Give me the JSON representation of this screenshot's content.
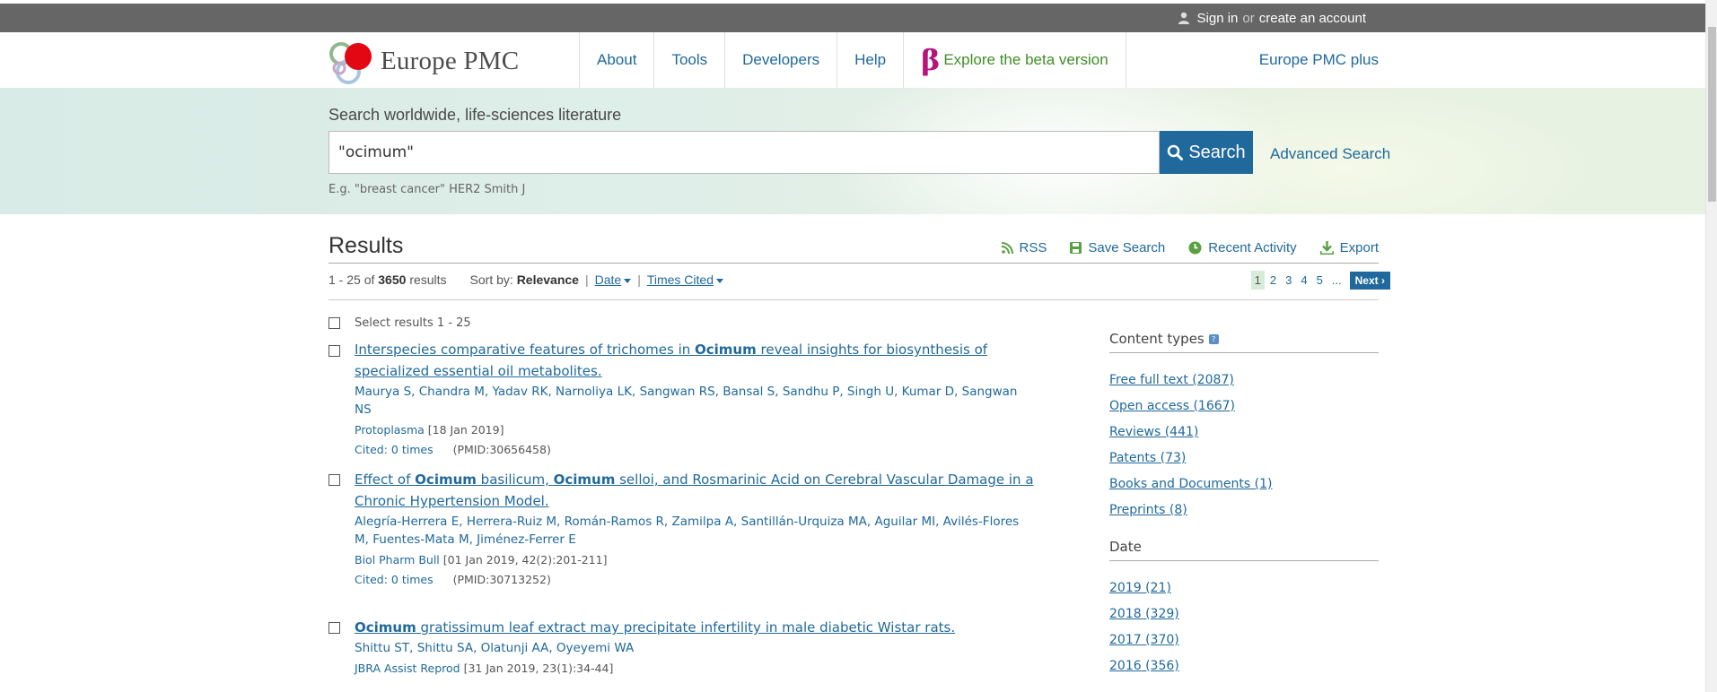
{
  "topbar": {
    "sign_in": "Sign in",
    "or": "or",
    "create_account": "create an account"
  },
  "header": {
    "logo_text": "Europe PMC",
    "nav": [
      "About",
      "Tools",
      "Developers",
      "Help"
    ],
    "beta_symbol": "β",
    "beta_label": "Explore the beta version",
    "plus": "Europe PMC plus"
  },
  "search": {
    "label": "Search worldwide, life-sciences literature",
    "value": "\"ocimum\"",
    "button": "Search",
    "advanced": "Advanced Search",
    "example": "E.g. \"breast cancer\" HER2 Smith J"
  },
  "results": {
    "heading": "Results",
    "tools": [
      "RSS",
      "Save Search",
      "Recent Activity",
      "Export"
    ],
    "range": "1 - 25 of",
    "total": "3650",
    "results_word": "results",
    "sort_by": "Sort by:",
    "sort_current": "Relevance",
    "sort_options": [
      "Date",
      "Times Cited"
    ],
    "pages": [
      "1",
      "2",
      "3",
      "4",
      "5",
      "..."
    ],
    "next": "Next",
    "select_all": "Select results 1 - 25",
    "items": [
      {
        "title_parts": [
          "Interspecies comparative features of trichomes in ",
          "Ocimum",
          " reveal insights for biosynthesis of specialized essential oil metabolites."
        ],
        "authors": "Maurya S, Chandra M, Yadav RK, Narnoliya LK, Sangwan RS, Bansal S, Sandhu P, Singh U, Kumar D, Sangwan NS",
        "journal": "Protoplasma",
        "date": "[18 Jan 2019]",
        "cited": "Cited: 0 times",
        "pmid": "(PMID:30656458)"
      },
      {
        "title_parts": [
          "Effect of ",
          "Ocimum",
          " basilicum, ",
          "Ocimum",
          " selloi, and Rosmarinic Acid on Cerebral Vascular Damage in a Chronic Hypertension Model."
        ],
        "authors": "Alegría-Herrera E, Herrera-Ruiz M, Román-Ramos R, Zamilpa A, Santillán-Urquiza MA, Aguilar MI, Avilés-Flores M, Fuentes-Mata M, Jiménez-Ferrer E",
        "journal": "Biol Pharm Bull",
        "date": "[01 Jan 2019, 42(2):201-211]",
        "cited": "Cited: 0 times",
        "pmid": "(PMID:30713252)"
      },
      {
        "title_parts": [
          "Ocimum",
          " gratissimum leaf extract may precipitate infertility in male diabetic Wistar rats."
        ],
        "authors": "Shittu ST, Shittu SA, Olatunji AA, Oyeyemi WA",
        "journal": "JBRA Assist Reprod",
        "date": "[31 Jan 2019, 23(1):34-44]"
      }
    ]
  },
  "sidebar": {
    "content_types_title": "Content types",
    "content_types": [
      "Free full text (2087)",
      "Open access (1667)",
      "Reviews (441)",
      "Patents (73)",
      "Books and Documents (1)",
      "Preprints (8)"
    ],
    "date_title": "Date",
    "dates": [
      "2019 (21)",
      "2018 (329)",
      "2017 (370)",
      "2016 (356)"
    ]
  },
  "colors": {
    "brand_blue": "#20699c",
    "beta_magenta": "#b5147a",
    "beta_green": "#3e8e24",
    "topbar": "#666666",
    "logo_red": "#e30613"
  }
}
